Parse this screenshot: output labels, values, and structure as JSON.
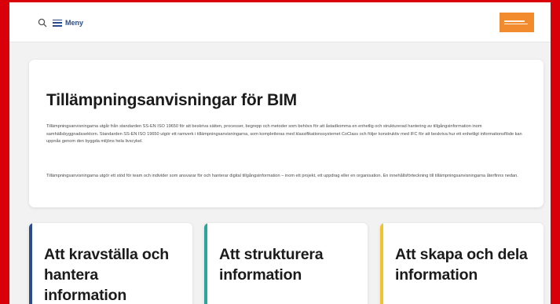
{
  "header": {
    "menu_label": "Meny",
    "search_icon": "search-icon",
    "menu_icon": "hamburger-icon",
    "logo_color": "#f28a2e"
  },
  "hero": {
    "title": "Tillämpningsanvisningar för BIM",
    "paragraph_1": "Tillämpningsanvisningarna utgår från standarden SS-EN ISO 19650 för att beskriva sätten, processer, begrepp och metoder som behövs för att åstadkomma en enhetlig och strukturerad hantering av tillgångsinformation inom samhällsbyggnadssektorn. Standarden SS-EN ISO 19650 utgör ett ramverk i tillämpningsanvisningarna, som kompletteras med klassifikationssystemet CoClass och följer konstruktiv med IFC för att beskriva hur ett enhetligt informationsflöde kan uppnås genom den byggda miljöns hela livscykel.",
    "paragraph_2": "Tillämpningsanvisningarna utgör ett stöd för team och individer som ansvarar för och hanterar digital tillgångsinformation – inom ett projekt, ett uppdrag eller en organisation. En innehållsförteckning till tillämpningsanvisningarna återfinns nedan."
  },
  "cards": [
    {
      "title": "Att kravställa och hantera information",
      "accent": "#2a4b8d"
    },
    {
      "title": "Att strukturera information",
      "accent": "#2aa59a"
    },
    {
      "title": "Att skapa och dela information",
      "accent": "#f2c12e"
    }
  ],
  "colors": {
    "frame_border": "#d9000a",
    "background": "#f2f2f3",
    "link_blue": "#2a4b8d"
  }
}
